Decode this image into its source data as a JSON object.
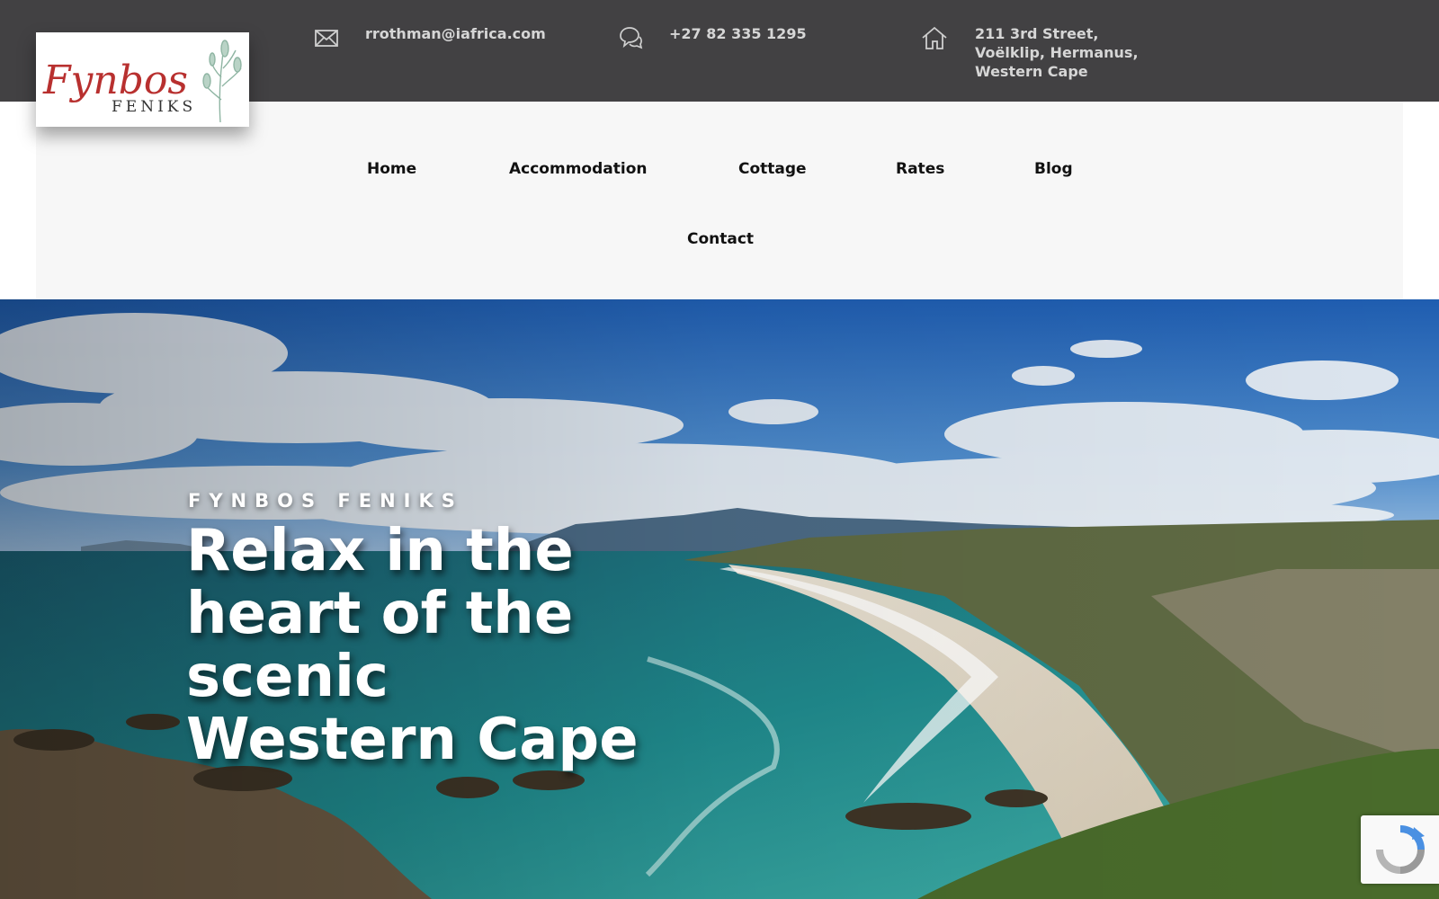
{
  "logo": {
    "script": "Fynbos",
    "sub": "FENIKS"
  },
  "topbar": {
    "email": "rrothman@iafrica.com",
    "phone": "+27 82 335 1295",
    "address": [
      "211 3rd Street,",
      "Voëlklip, Hermanus,",
      "Western Cape"
    ],
    "email_icon": "envelope-icon",
    "phone_icon": "chat-bubbles-icon",
    "address_icon": "house-icon"
  },
  "nav": {
    "items": [
      "Home",
      "Accommodation",
      "Cottage",
      "Rates",
      "Blog",
      "Contact"
    ]
  },
  "hero": {
    "kicker": "FYNBOS FENIKS",
    "headline": [
      "Relax in the",
      "heart of the",
      "scenic",
      "Western Cape"
    ]
  },
  "colors": {
    "topbar": "#424143",
    "nav_bg": "#f7f7f7",
    "logo_red": "#b8302f",
    "logo_green": "#8fb5a3"
  }
}
